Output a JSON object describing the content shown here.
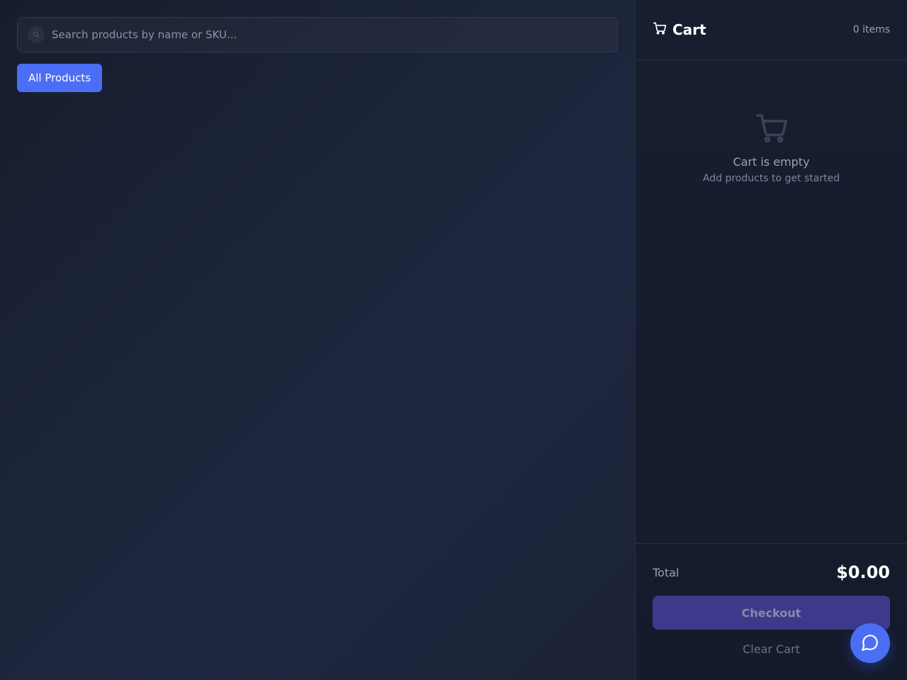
{
  "search": {
    "placeholder": "Search products by name or SKU...",
    "value": "",
    "icon": "search-icon"
  },
  "filters": [
    {
      "label": "All Products",
      "active": true
    }
  ],
  "cart": {
    "title": "Cart",
    "count_label": "0 items",
    "icon": "cart-icon",
    "empty_title": "Cart is empty",
    "empty_subtitle": "Add products to get started",
    "total_label": "Total",
    "total_value": "$0.00",
    "checkout_label": "Checkout",
    "clear_label": "Clear Cart"
  },
  "chat": {
    "icon": "chat-bubble-icon"
  },
  "colors": {
    "accent": "#4c6ef5",
    "background": "#1a2133",
    "checkout_disabled": "#3d3a8c"
  }
}
